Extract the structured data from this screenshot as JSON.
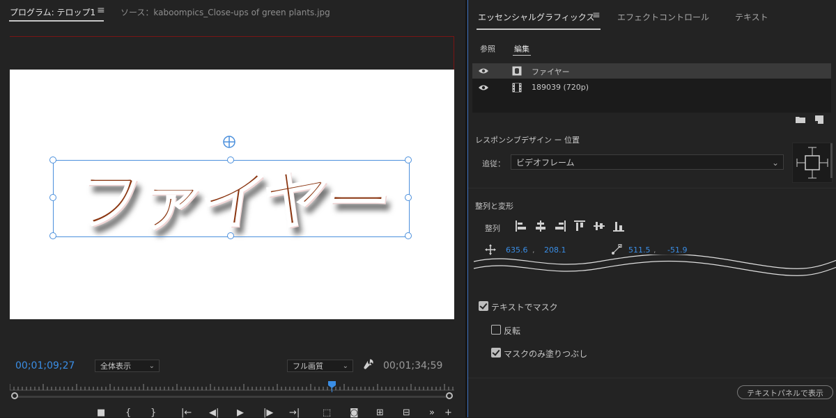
{
  "program_monitor": {
    "tab_program": "プログラム: テロップ1",
    "tab_source": "ソース：kaboompics_Close-ups of green plants.jpg",
    "canvas_text": "ファイヤー",
    "timecode_current": "00;01;09;27",
    "zoom_option": "全体表示",
    "quality_option": "フル画質",
    "timecode_duration": "00;01;34;59"
  },
  "essential_graphics": {
    "tabs": [
      "エッセンシャルグラフィックス",
      "エフェクトコントロール",
      "テキスト"
    ],
    "subtabs": [
      "参照",
      "編集"
    ],
    "layers": [
      {
        "name": "ファイヤー",
        "type": "text-layer-icon",
        "selected": true
      },
      {
        "name": "189039 (720p)",
        "type": "film-layer-icon",
        "selected": false
      }
    ],
    "responsive_design_title": "レスポンシブデザイン ー 位置",
    "follow_label": "追従：",
    "follow_value": "ビデオフレーム",
    "align_transform_title": "整列と変形",
    "align_label": "整列",
    "position_x": "635.6",
    "position_y": "208.1",
    "anchor_x": "511.5",
    "anchor_y": "-51.9",
    "comma": ",",
    "checkboxes": [
      {
        "label": "テキストでマスク",
        "checked": true
      },
      {
        "label": "反転",
        "checked": false
      },
      {
        "label": "マスクのみ塗りつぶし",
        "checked": true
      }
    ],
    "text_panel_button": "テキストパネルで表示"
  },
  "colors": {
    "accent_blue": "#3a8ee6",
    "panel_bg": "#232323",
    "text_fill": "#8a3510"
  }
}
